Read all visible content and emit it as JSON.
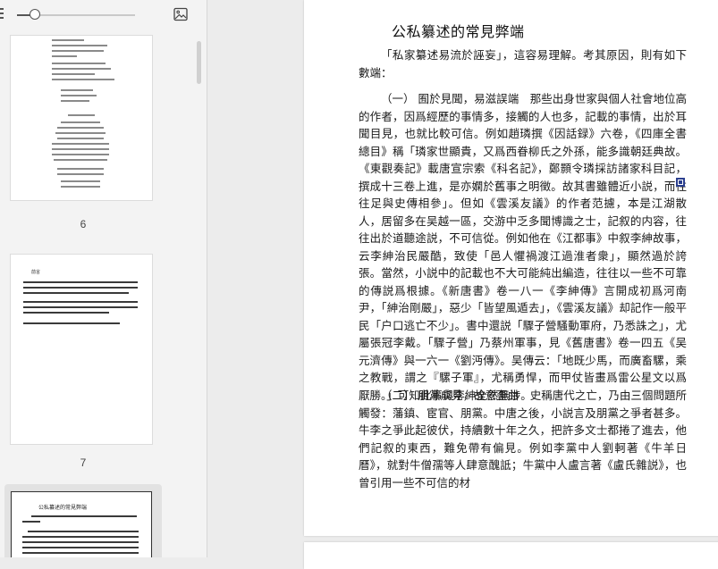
{
  "toolbar": {
    "zoom_percent": 15
  },
  "thumbnails": [
    {
      "page_label": "6"
    },
    {
      "page_label": "7"
    },
    {
      "page_label": "",
      "title": "公私纂述的常見弊端",
      "intro": "「私家纂述易流於誣妄」，這容易理解。考其原因，則有如下數端："
    }
  ],
  "thumb7": {
    "heading": "前言"
  },
  "document": {
    "title": "公私纂述的常見弊端",
    "para1": "「私家纂述易流於誣妄」，這容易理解。考其原因，則有如下數端：",
    "para2": "（一） 囿於見聞，易滋誤端　那些出身世家與個人社會地位高的作者，因爲經歷的事情多，接觸的人也多，記載的事情，出於耳聞目見，也就比較可信。例如趙璘撰《因話録》六卷，《四庫全書總目》稱「璘家世顯貴，又爲西眷柳氏之外孫，能多識朝廷典故。《東觀奏記》載唐宣宗索《科名記》，鄭顥令璘採訪諸家科目記，撰成十三卷上進，是亦嫻於舊事之明徵。故其書雖體近小説，而往往足與史傳相參」。但如《雲溪友議》的作者范攄，本是江湖散人，居留多在吴越一區，交游中乏多聞博識之士，記叙的内容，往往出於道聽途説，不可信從。例如他在《江都事》中叙李紳故事，云李紳治民嚴酷，致使「邑人懼禍渡江過淮者衆」，顯然過於誇張。當然，小説中的記載也不大可能純出編造，往往以一些不可靠的傳説爲根據。《新唐書》卷一八一《李紳傳》言開成初爲河南尹，「紳治剛嚴」，惡少「皆望風遁去」，《雲溪友議》却記作一般平民「户口逃亡不少」。書中還説「驟子營騷動軍府，乃悉誅之」，尤屬張冠李戴。「驟子營」乃蔡州軍事，見《舊唐書》卷一四五《吴元濟傳》與一六一《劉沔傳》。吴傳云：「地既少馬，而廣畜騾，乘之教戰，謂之『騾子軍』，尤稱勇悍，而甲仗皆畫爲雷公星文以爲厭勝。」可知此事與李紳全然無涉。",
    "para3": "（二） 朋黨成見，故意歪曲　史稱唐代之亡，乃由三個問題所觸發：藩鎮、宦官、朋黨。中唐之後，小説言及朋黨之爭者甚多。牛李之爭此起彼伏，持續數十年之久，把許多文士都捲了進去，他們記叙的東西，難免帶有偏見。例如李黨中人劉軻著《牛羊日曆》，就對牛僧孺等人肆意醜詆；牛黨中人盧言著《盧氏雜説》，也曾引用一些不可信的材"
  }
}
